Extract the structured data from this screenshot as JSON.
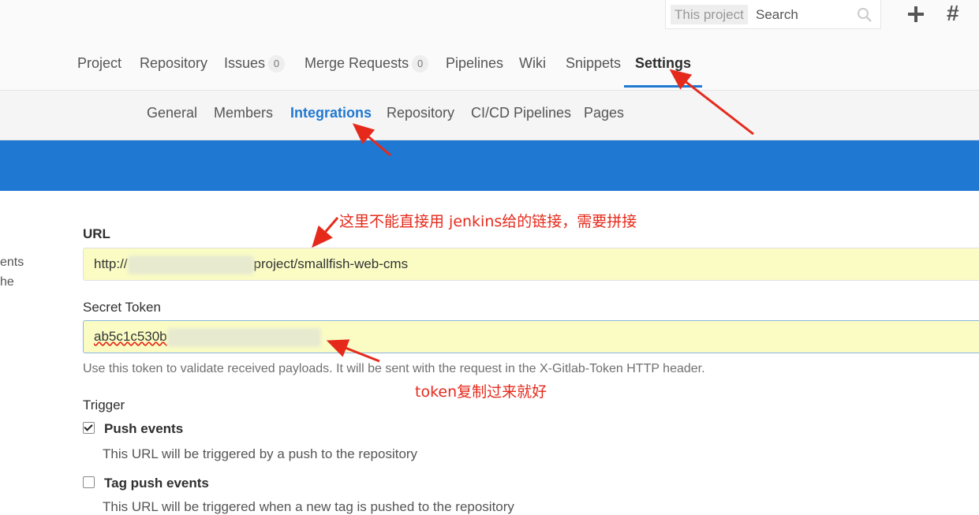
{
  "search": {
    "scope": "This project",
    "placeholder": "Search"
  },
  "header_icons": {
    "plus": "plus-icon",
    "hash": "#"
  },
  "nav": {
    "project": "Project",
    "repository": "Repository",
    "issues": "Issues",
    "issues_count": "0",
    "merge_requests": "Merge Requests",
    "mr_count": "0",
    "pipelines": "Pipelines",
    "wiki": "Wiki",
    "snippets": "Snippets",
    "settings": "Settings"
  },
  "subnav": {
    "general": "General",
    "members": "Members",
    "integrations": "Integrations",
    "repository": "Repository",
    "cicd": "CI/CD Pipelines",
    "pages": "Pages"
  },
  "left_text": {
    "line1": "ents",
    "line2": "he"
  },
  "form": {
    "url_label": "URL",
    "url_prefix": "http://",
    "url_suffix": "project/smallfish-web-cms",
    "token_label": "Secret Token",
    "token_value": "ab5c1c530b",
    "token_help": "Use this token to validate received payloads. It will be sent with the request in the X-Gitlab-Token HTTP header.",
    "trigger_label": "Trigger",
    "push_label": "Push events",
    "push_help": "This URL will be triggered by a push to the repository",
    "tag_label": "Tag push events",
    "tag_help": "This URL will be triggered when a new tag is pushed to the repository"
  },
  "annotations": {
    "url_note": "这里不能直接用 jenkins给的链接，需要拼接",
    "token_note": "token复制过来就好"
  },
  "colors": {
    "accent": "#1f78d1",
    "annotation": "#e52a1c",
    "field_bg": "#fafcc4"
  }
}
